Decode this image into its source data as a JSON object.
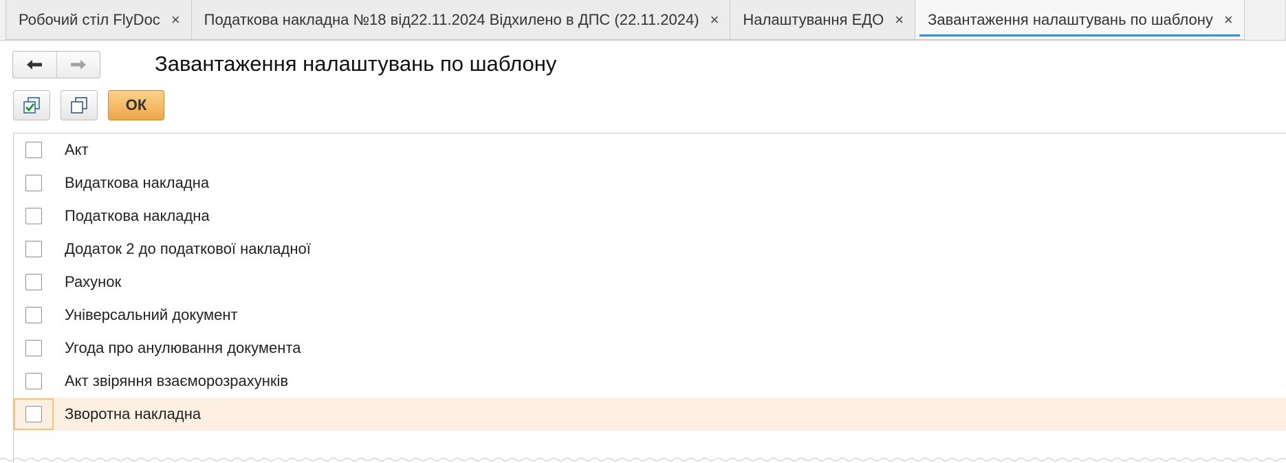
{
  "tabs": [
    {
      "label": "Робочий стіл FlyDoc",
      "active": false
    },
    {
      "label": "Податкова накладна №18 від22.11.2024 Відхилено в ДПС (22.11.2024)",
      "active": false
    },
    {
      "label": "Налаштування ЕДО",
      "active": false
    },
    {
      "label": "Завантаження налаштувань по шаблону",
      "active": true
    }
  ],
  "close_glyph": "×",
  "nav": {
    "back_icon": "arrow-left-icon",
    "forward_icon": "arrow-right-icon"
  },
  "page": {
    "title": "Завантаження налаштувань по шаблону"
  },
  "toolbar": {
    "check_all_icon": "check-all-icon",
    "uncheck_all_icon": "uncheck-all-icon",
    "ok_label": "ОК",
    "ok_color": "#f0a64a"
  },
  "list": {
    "items": [
      {
        "label": "Акт",
        "checked": false
      },
      {
        "label": "Видаткова накладна",
        "checked": false
      },
      {
        "label": "Податкова накладна",
        "checked": false
      },
      {
        "label": "Додаток 2 до податкової накладної",
        "checked": false
      },
      {
        "label": "Рахунок",
        "checked": false
      },
      {
        "label": "Універсальний документ",
        "checked": false
      },
      {
        "label": "Угода про анулювання документа",
        "checked": false
      },
      {
        "label": "Акт звіряння взаєморозрахунків",
        "checked": false
      },
      {
        "label": "Зворотна накладна",
        "checked": false,
        "selected": true
      }
    ],
    "selected_color": "#fdf0e2"
  },
  "accent_color": "#3d8ecb"
}
